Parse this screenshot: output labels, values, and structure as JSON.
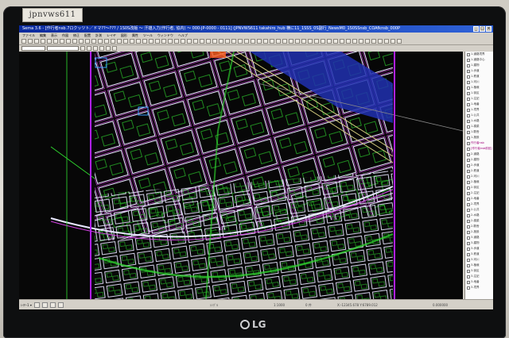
{
  "sticker": {
    "text": "jpnvws611"
  },
  "window": {
    "title": "Sema 3.6 - [作行者nsb.7ロクッツト／ドマ??～??? / 1S0S改版 ～ 汗雄入力(作行者, 協内) ～ 000-JP-0000 - 0111] (JPNVWS611 takahiro_hub 横に11_1SSS_0S副行_NewsM0_1S0SSnsb_COAfknsb_000P",
    "minimize": "_",
    "maximize": "□",
    "close": "×"
  },
  "menu": {
    "items": [
      "ファイル",
      "編集",
      "表示",
      "作図",
      "修正",
      "配置",
      "計測",
      "レイヤ",
      "図形",
      "属性",
      "ツール",
      "ウィンドウ",
      "ヘルプ"
    ]
  },
  "layers": {
    "items": [
      {
        "label": "1-道路境界",
        "highlight": false
      },
      {
        "label": "1-道路中心",
        "highlight": false
      },
      {
        "label": "1-建物",
        "highlight": false
      },
      {
        "label": "1-歩道",
        "highlight": false
      },
      {
        "label": "1-鉄道",
        "highlight": false
      },
      {
        "label": "1-河川",
        "highlight": false
      },
      {
        "label": "1-植栽",
        "highlight": false
      },
      {
        "label": "1-街区",
        "highlight": false
      },
      {
        "label": "1-注記",
        "highlight": false
      },
      {
        "label": "1-地番",
        "highlight": false
      },
      {
        "label": "1-境界",
        "highlight": false
      },
      {
        "label": "1-公共",
        "highlight": false
      },
      {
        "label": "1-水路",
        "highlight": false
      },
      {
        "label": "1-橋梁",
        "highlight": false
      },
      {
        "label": "1-駅舎",
        "highlight": false
      },
      {
        "label": "1-施設",
        "highlight": false
      },
      {
        "label": "作行者nsb",
        "highlight": true
      },
      {
        "label": "[作行者nsb前回]",
        "highlight": true
      },
      {
        "label": "2-道路",
        "highlight": false
      },
      {
        "label": "2-建物",
        "highlight": false
      },
      {
        "label": "2-歩道",
        "highlight": false
      },
      {
        "label": "2-鉄道",
        "highlight": false
      },
      {
        "label": "2-河川",
        "highlight": false
      },
      {
        "label": "2-植栽",
        "highlight": false
      },
      {
        "label": "2-街区",
        "highlight": false
      },
      {
        "label": "2-注記",
        "highlight": false
      },
      {
        "label": "2-地番",
        "highlight": false
      },
      {
        "label": "2-境界",
        "highlight": false
      },
      {
        "label": "2-公共",
        "highlight": false
      },
      {
        "label": "2-水路",
        "highlight": false
      },
      {
        "label": "2-橋梁",
        "highlight": false
      },
      {
        "label": "2-駅舎",
        "highlight": false
      },
      {
        "label": "2-施設",
        "highlight": false
      },
      {
        "label": "3-道路",
        "highlight": false
      },
      {
        "label": "3-建物",
        "highlight": false
      },
      {
        "label": "3-歩道",
        "highlight": false
      },
      {
        "label": "3-鉄道",
        "highlight": false
      },
      {
        "label": "3-河川",
        "highlight": false
      },
      {
        "label": "3-植栽",
        "highlight": false
      },
      {
        "label": "3-街区",
        "highlight": false
      },
      {
        "label": "3-注記",
        "highlight": false
      },
      {
        "label": "3-地番",
        "highlight": false
      },
      {
        "label": "3-境界",
        "highlight": false
      }
    ]
  },
  "status": {
    "left_label": "ﾚｲﾔｰ1 ▾",
    "mode": "ｼﾝｸﾞﾙ",
    "scale": "1:1000",
    "count": "0 件",
    "coords": "X:-12345.678  Y:6789.012",
    "snap": "0.000000"
  },
  "brand": {
    "logo": "LG"
  },
  "colors": {
    "roads_white": "#e8e8ff",
    "roads_magenta": "#d040e0",
    "buildings_green": "#30e030",
    "building_blue": "#3aa0ff",
    "rail_yellow": "#d8d080",
    "river_blue": "#2030b0",
    "border_purple": "#b020ff",
    "orange": "#ff6020"
  }
}
